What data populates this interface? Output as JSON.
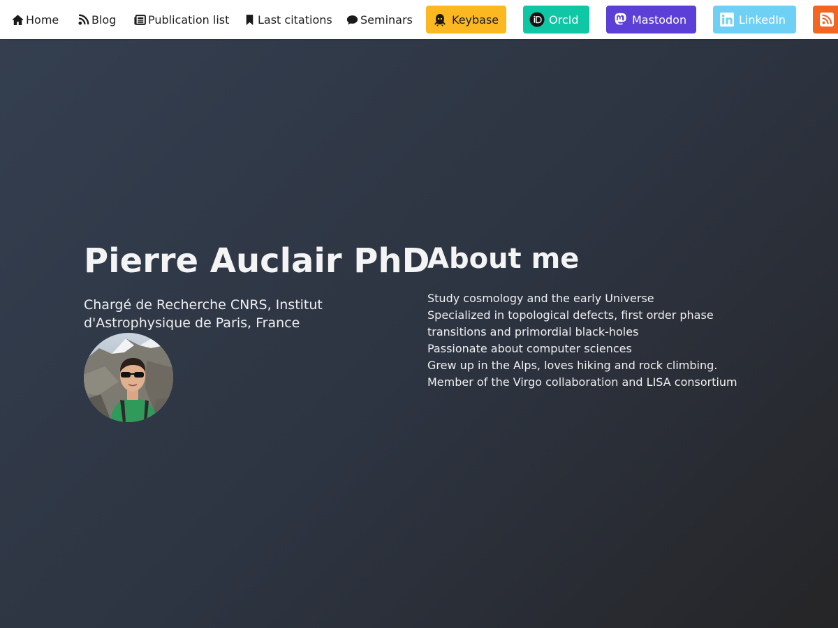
{
  "nav": {
    "links": [
      {
        "label": "Home",
        "icon": "home-icon"
      },
      {
        "label": "Blog",
        "icon": "rss-feed-icon"
      },
      {
        "label": "Publication list",
        "icon": "newspaper-icon"
      },
      {
        "label": "Last citations",
        "icon": "bookmark-icon"
      },
      {
        "label": "Seminars",
        "icon": "speech-bubble-icon"
      }
    ],
    "buttons": [
      {
        "label": "Keybase",
        "icon": "keybase-icon",
        "bg": "#fcb820",
        "fg": "#1a1a1a"
      },
      {
        "label": "OrcId",
        "icon": "orcid-icon",
        "bg": "#0fc6a5",
        "fg": "#ffffff"
      },
      {
        "label": "Mastodon",
        "icon": "mastodon-icon",
        "bg": "#5b3fd6",
        "fg": "#ffffff"
      },
      {
        "label": "LinkedIn",
        "icon": "linkedin-icon",
        "bg": "#6fd0f6",
        "fg": "#ffffff"
      },
      {
        "label": "",
        "icon": "rss-icon",
        "bg": "#f26522",
        "fg": "#ffffff"
      }
    ]
  },
  "hero": {
    "name": "Pierre Auclair PhD",
    "affiliation": "Chargé de Recherche CNRS, Institut d'Astrophysique de Paris, France",
    "avatar": "profile-photo"
  },
  "about": {
    "title": "About me",
    "items": [
      "Study cosmology and the early Universe",
      "Specialized in topological defects, first order phase transitions and primordial black-holes",
      "Passionate about computer sciences",
      "Grew up in the Alps, loves hiking and rock climbing.",
      "Member of the Virgo collaboration and LISA consortium"
    ]
  },
  "colors": {
    "background_top": "#343f50",
    "background_bottom": "#252527",
    "navbar": "#ffffff"
  }
}
